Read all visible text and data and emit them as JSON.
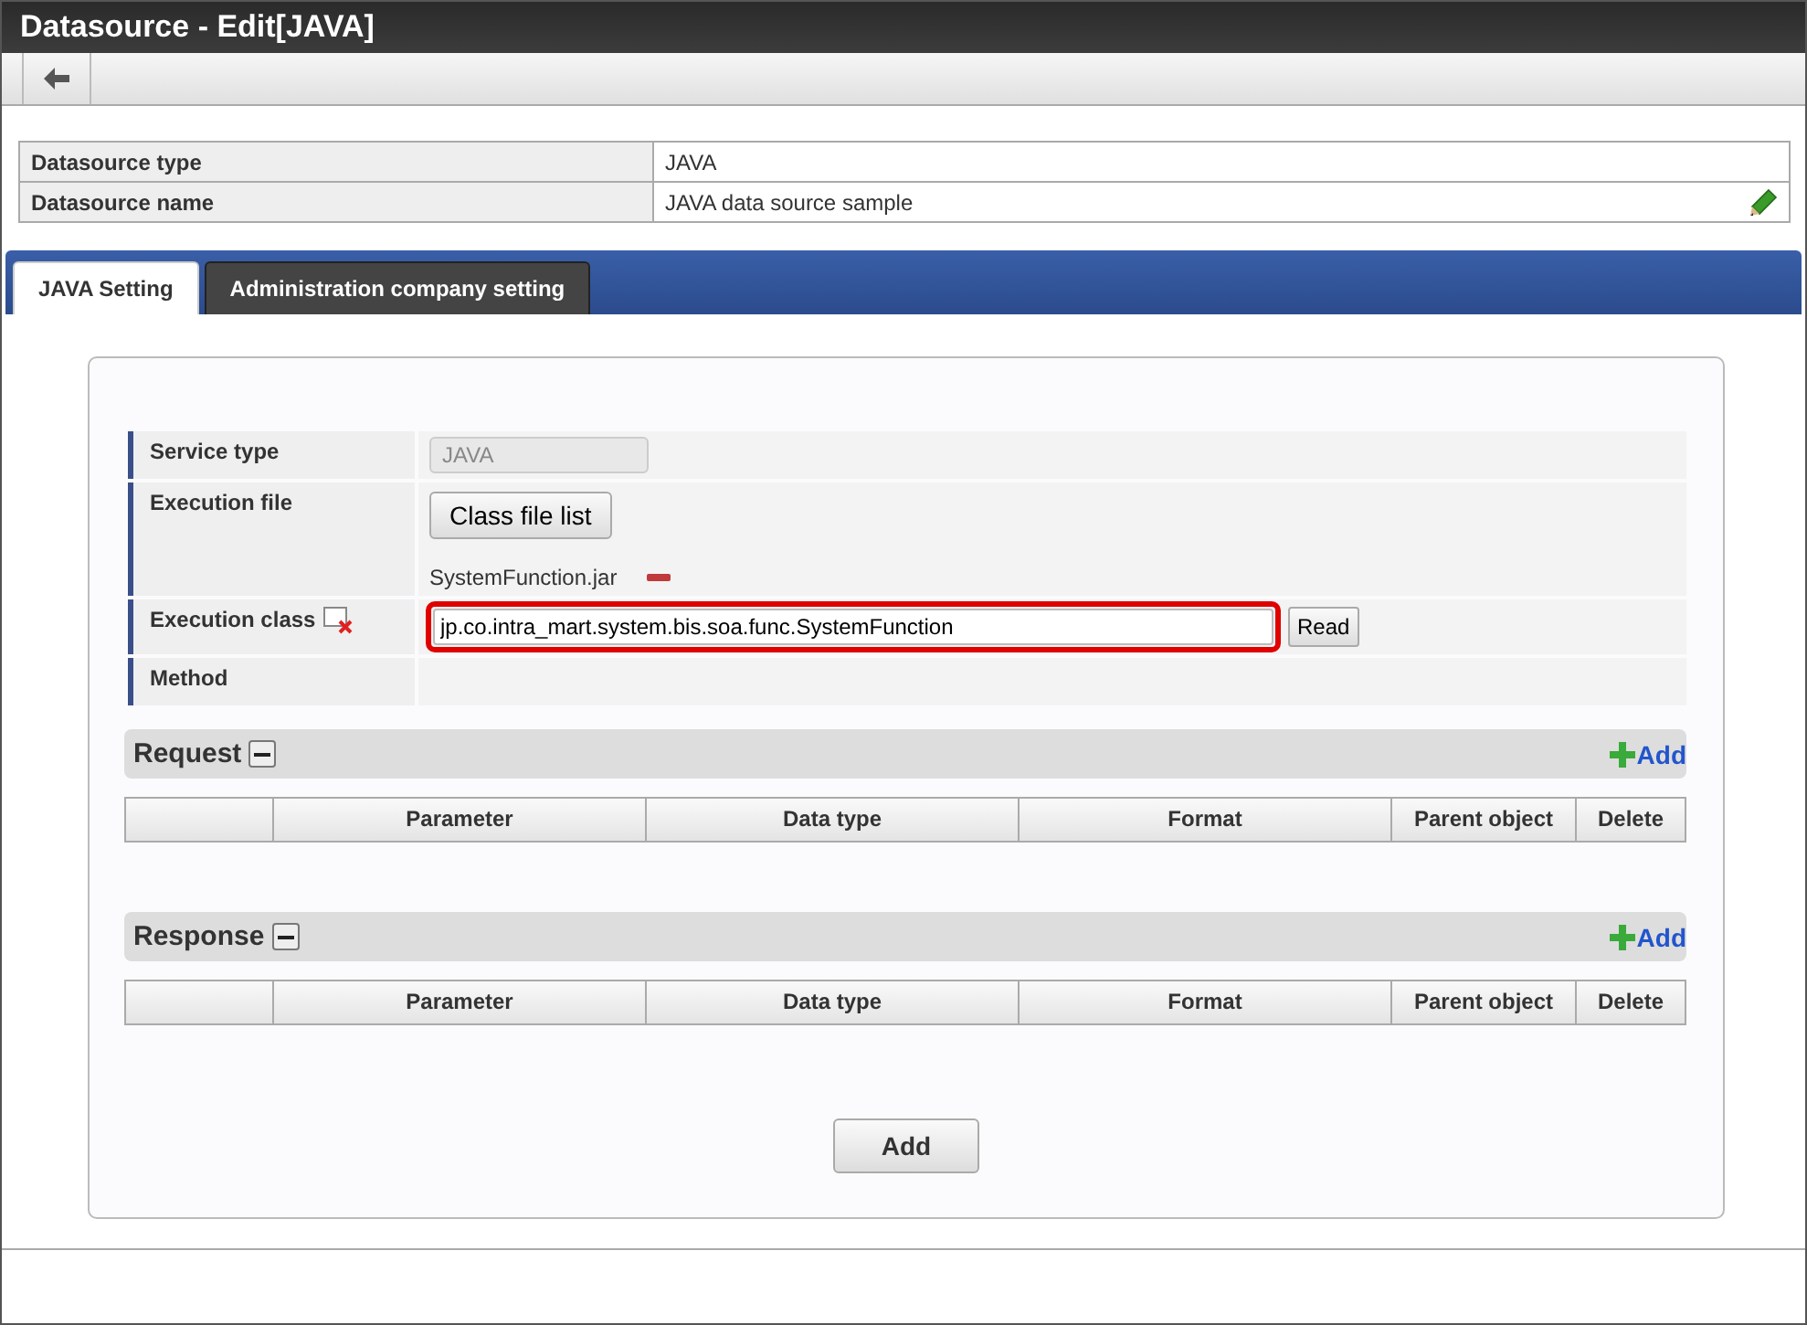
{
  "window": {
    "title": "Datasource - Edit[JAVA]"
  },
  "info": [
    {
      "label": "Datasource type",
      "value": "JAVA",
      "editable": false
    },
    {
      "label": "Datasource name",
      "value": "JAVA data source sample",
      "editable": true
    }
  ],
  "tabs": [
    {
      "label": "JAVA Setting",
      "selected": true
    },
    {
      "label": "Administration company setting",
      "selected": false
    }
  ],
  "form": {
    "rows": [
      {
        "kind": "readonly",
        "label": "Service type",
        "value": "JAVA"
      },
      {
        "kind": "files",
        "label": "Execution file",
        "button": "Class file list",
        "files": [
          "SystemFunction.jar"
        ]
      },
      {
        "kind": "class",
        "label": "Execution class",
        "value": "jp.co.intra_mart.system.bis.soa.func.SystemFunction",
        "button": "Read",
        "highlighted": true
      },
      {
        "kind": "empty",
        "label": "Method"
      }
    ]
  },
  "sections": [
    {
      "title": "Request",
      "add": "Add",
      "columns": [
        "Parameter",
        "Data type",
        "Format",
        "Parent object",
        "Delete"
      ]
    },
    {
      "title": "Response",
      "add": "Add",
      "columns": [
        "Parameter",
        "Data type",
        "Format",
        "Parent object",
        "Delete"
      ]
    }
  ],
  "footer_button": "Add"
}
